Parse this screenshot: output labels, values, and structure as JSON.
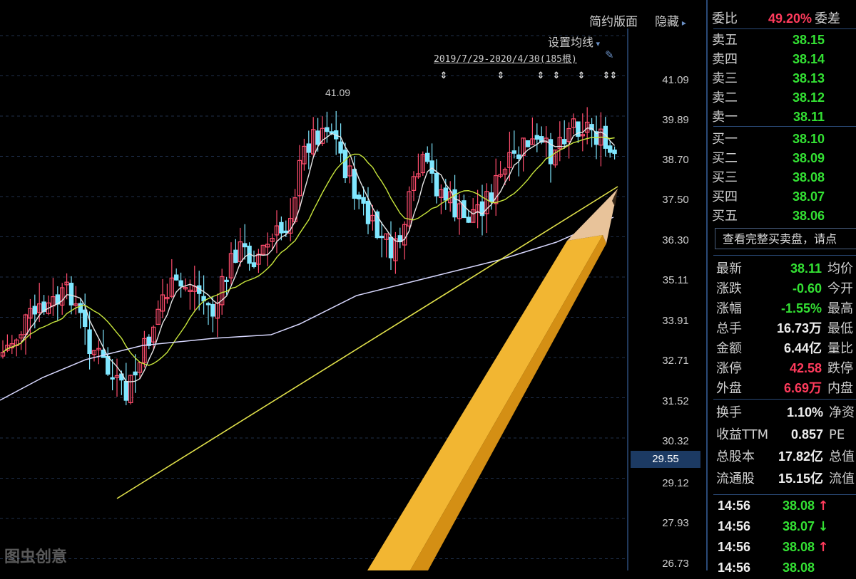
{
  "chart_toolbar": {
    "simple_layout": "简约版面",
    "hide": "隐藏",
    "ma_settings": "设置均线",
    "range_label": "2019/7/29-2020/4/30(185根)"
  },
  "chart_data": {
    "type": "candlestick",
    "y_axis_ticks": [
      "41.09",
      "39.89",
      "38.70",
      "37.50",
      "36.30",
      "35.11",
      "33.91",
      "32.71",
      "31.52",
      "30.32",
      "29.12",
      "27.93",
      "26.73"
    ],
    "ylim": [
      26.73,
      41.09
    ],
    "high_annotation": "41.09",
    "current_price_tag": "29.55",
    "series_colors": {
      "up": "#ff4d6d",
      "down": "#7fe7ff",
      "ma_fast": "#e6e6e6",
      "ma_mid": "#c8e63c",
      "ma_slow": "#d8d8ff",
      "trendline": "#e0e04a"
    }
  },
  "order_book": {
    "ratio_label": "委比",
    "ratio_value": "49.20%",
    "diff_label": "委差",
    "asks": [
      {
        "label": "卖五",
        "price": "38.15"
      },
      {
        "label": "卖四",
        "price": "38.14"
      },
      {
        "label": "卖三",
        "price": "38.13"
      },
      {
        "label": "卖二",
        "price": "38.12"
      },
      {
        "label": "卖一",
        "price": "38.11"
      }
    ],
    "bids": [
      {
        "label": "买一",
        "price": "38.10"
      },
      {
        "label": "买二",
        "price": "38.09"
      },
      {
        "label": "买三",
        "price": "38.08"
      },
      {
        "label": "买四",
        "price": "38.07"
      },
      {
        "label": "买五",
        "price": "38.06"
      }
    ],
    "full_book_button": "查看完整买卖盘，请点"
  },
  "quote": {
    "rows": [
      {
        "label": "最新",
        "value": "38.11",
        "color": "green",
        "right": "均价"
      },
      {
        "label": "涨跌",
        "value": "-0.60",
        "color": "green",
        "right": "今开"
      },
      {
        "label": "涨幅",
        "value": "-1.55%",
        "color": "green",
        "right": "最高"
      },
      {
        "label": "总手",
        "value": "16.73万",
        "color": "white",
        "right": "最低"
      },
      {
        "label": "金额",
        "value": "6.44亿",
        "color": "white",
        "right": "量比"
      },
      {
        "label": "涨停",
        "value": "42.58",
        "color": "red",
        "right": "跌停"
      },
      {
        "label": "外盘",
        "value": "6.69万",
        "color": "red",
        "right": "内盘"
      }
    ],
    "rows2": [
      {
        "label": "换手",
        "value": "1.10%",
        "color": "white",
        "right": "净资"
      },
      {
        "label": "收益TTM",
        "value": "0.857",
        "color": "white",
        "right": "PE"
      },
      {
        "label": "总股本",
        "value": "17.82亿",
        "color": "white",
        "right": "总值"
      },
      {
        "label": "流通股",
        "value": "15.15亿",
        "color": "white",
        "right": "流值"
      }
    ]
  },
  "ticks": [
    {
      "time": "14:56",
      "price": "38.08",
      "dir": "up"
    },
    {
      "time": "14:56",
      "price": "38.07",
      "dir": "down"
    },
    {
      "time": "14:56",
      "price": "38.08",
      "dir": "up"
    },
    {
      "time": "14:56",
      "price": "38.08",
      "dir": ""
    }
  ],
  "watermark": "图虫创意"
}
